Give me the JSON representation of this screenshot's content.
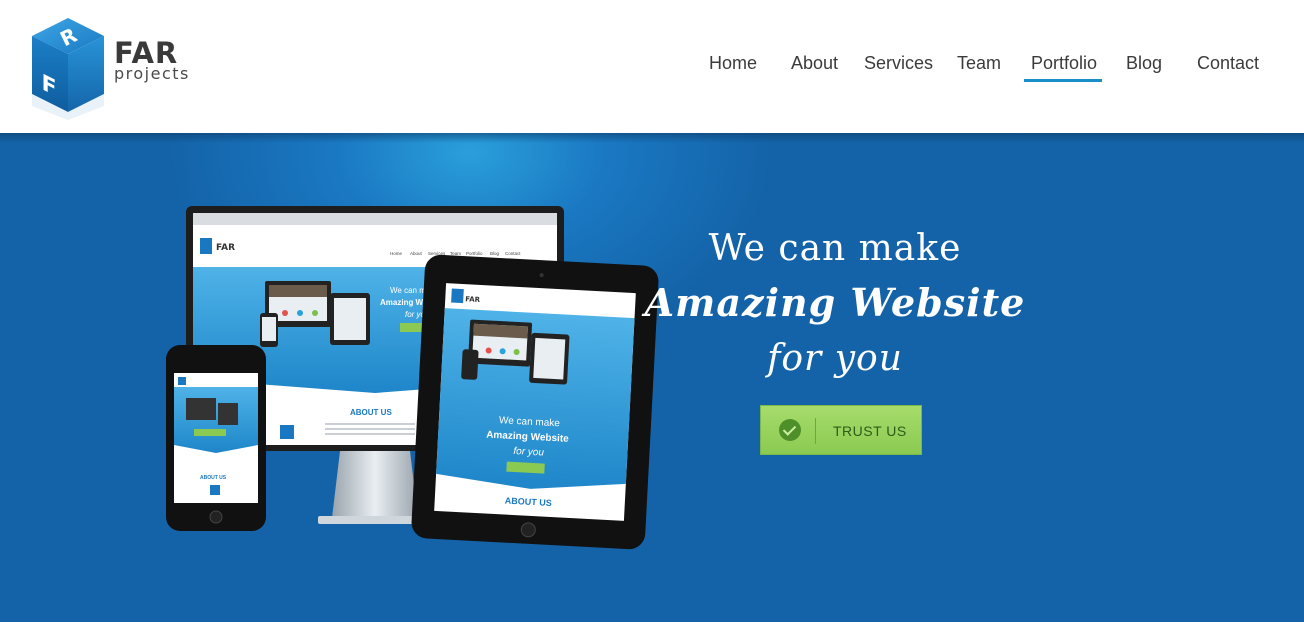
{
  "brand": {
    "logo_cube_letters": [
      "R",
      "F",
      "A"
    ],
    "name": "FAR",
    "tagline": "projects",
    "colors": {
      "cube_blue": "#1a78c2",
      "text_dark": "#3a3a3a"
    }
  },
  "nav": {
    "items": [
      {
        "label": "Home"
      },
      {
        "label": "About"
      },
      {
        "label": "Services"
      },
      {
        "label": "Team"
      },
      {
        "label": "Portfolio",
        "active": true
      },
      {
        "label": "Blog"
      },
      {
        "label": "Contact"
      }
    ],
    "active_underline_color": "#1a8fc7"
  },
  "hero": {
    "headline_line1": "We can make",
    "headline_line2": "Amazing Website",
    "headline_line3": "for you",
    "cta_label": "TRUST US",
    "cta_icon": "check-circle-icon",
    "background_color": "#1463a8",
    "cta_color": "#8bca52"
  },
  "devices_screens": {
    "monitor_nav": [
      "Home",
      "About",
      "Services",
      "Team",
      "Portfolio",
      "Blog",
      "Contact"
    ],
    "screen_brand": "FAR",
    "screen_line1": "We can make",
    "screen_line2": "Amazing Website",
    "screen_line3": "for you",
    "screen_section": "ABOUT US"
  }
}
